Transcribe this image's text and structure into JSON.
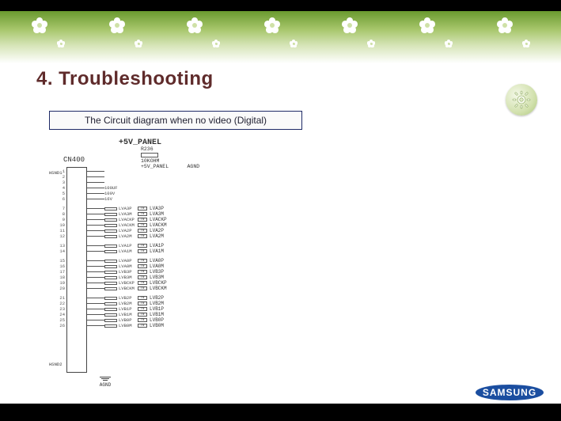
{
  "header": {
    "title": "4. Troubleshooting",
    "subtitle": "The Circuit diagram when no video (Digital)"
  },
  "brand": {
    "name": "SAMSUNG"
  },
  "circuit": {
    "voltage_rail": "+5V_PANEL",
    "connector": "CN400",
    "gnd_label": "AGND",
    "resistor_ref": "R236",
    "resistor_val": "10KOHM",
    "pullup_note": "+5V_PANEL",
    "cap_rows": [
      {
        "label": "100UF"
      },
      {
        "label": "100V"
      },
      {
        "label": "16V"
      }
    ],
    "section1": [
      {
        "net": "LVA3P",
        "label": "LVA3P"
      },
      {
        "net": "LVA3M",
        "label": "LVA3M"
      },
      {
        "net": "LVACKP",
        "label": "LVACKP"
      },
      {
        "net": "LVACKM",
        "label": "LVACKM"
      },
      {
        "net": "LVA2P",
        "label": "LVA2P"
      },
      {
        "net": "LVA2M",
        "label": "LVA2M"
      }
    ],
    "section2": [
      {
        "net": "LVA1P",
        "label": "LVA1P"
      },
      {
        "net": "LVA1M",
        "label": "LVA1M"
      }
    ],
    "section3": [
      {
        "net": "LVA0P",
        "label": "LVA0P"
      },
      {
        "net": "LVA0M",
        "label": "LVA0M"
      },
      {
        "net": "LVB3P",
        "label": "LVB3P"
      },
      {
        "net": "LVB3M",
        "label": "LVB3M"
      },
      {
        "net": "LVBCKP",
        "label": "LVBCKP"
      },
      {
        "net": "LVBCKM",
        "label": "LVBCKM"
      }
    ],
    "section4": [
      {
        "net": "LVB2P",
        "label": "LVB2P"
      },
      {
        "net": "LVB2M",
        "label": "LVB2M"
      },
      {
        "net": "LVB1P",
        "label": "LVB1P"
      },
      {
        "net": "LVB1M",
        "label": "LVB1M"
      },
      {
        "net": "LVB0P",
        "label": "LVB0P"
      },
      {
        "net": "LVB0M",
        "label": "LVB0M"
      }
    ],
    "side_refs": [
      "HSND1",
      "HSND2"
    ],
    "agnd_right": "AGND"
  }
}
